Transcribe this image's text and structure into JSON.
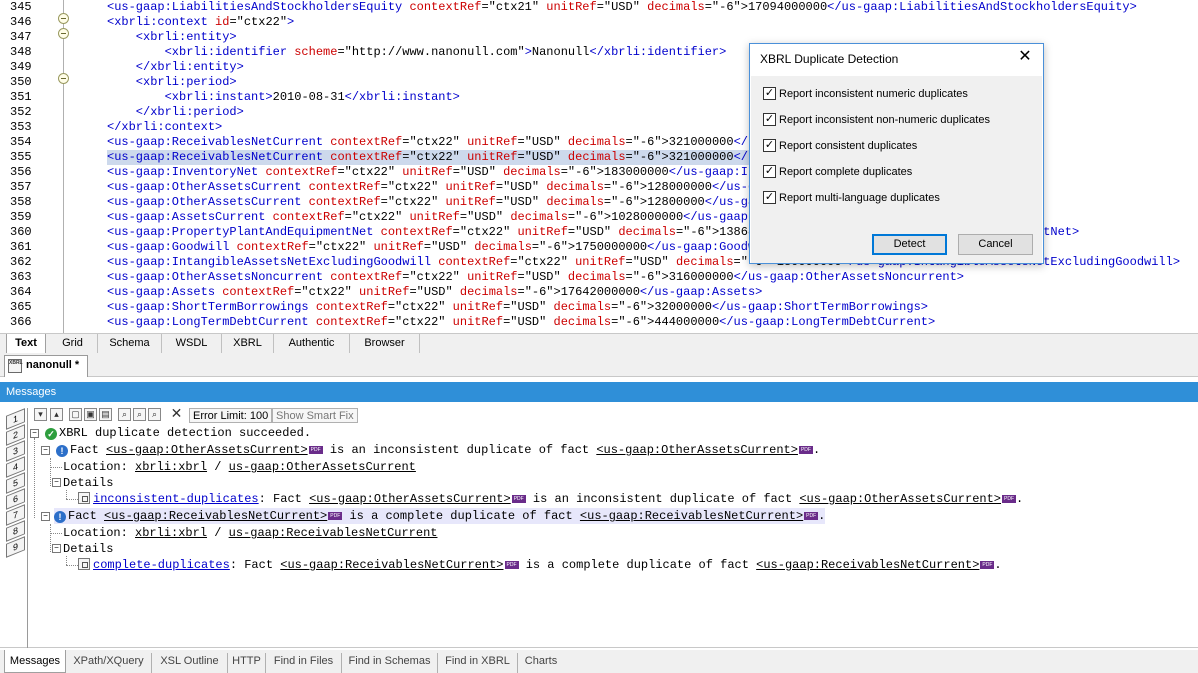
{
  "colors": {
    "tag": "#0000cc",
    "attr_name": "#cc0000",
    "attr_value": "#000000",
    "text": "#000000",
    "highlight_line": "#cdd9ec",
    "messages_header": "#2f8fd8",
    "highlight_message": "#e7e7fb"
  },
  "editor": {
    "lines": [
      {
        "num": "345",
        "segments": [
          [
            "t",
            "<us-gaap:LiabilitiesAndStockholdersEquity "
          ],
          [
            "a",
            "contextRef"
          ],
          [
            "x",
            "=\"ctx21\" "
          ],
          [
            "a",
            "unitRef"
          ],
          [
            "x",
            "=\"USD\" "
          ],
          [
            "a",
            "decimals"
          ],
          [
            "x",
            "=\"-6\">17094000000"
          ],
          [
            "t",
            "</us-gaap:LiabilitiesAndStockholdersEquity>"
          ]
        ]
      },
      {
        "num": "346",
        "segments": [
          [
            "t",
            "<xbrli:context "
          ],
          [
            "a",
            "id"
          ],
          [
            "x",
            "=\"ctx22\""
          ],
          [
            "t",
            ">"
          ]
        ]
      },
      {
        "num": "347",
        "segments": [
          [
            "t",
            "    <xbrli:entity>"
          ]
        ]
      },
      {
        "num": "348",
        "segments": [
          [
            "t",
            "        <xbrli:identifier "
          ],
          [
            "a",
            "scheme"
          ],
          [
            "x",
            "=\"http://www.nanonull.com\""
          ],
          [
            "t",
            ">"
          ],
          [
            "x",
            "Nanonull"
          ],
          [
            "t",
            "</xbrli:identifier>"
          ]
        ]
      },
      {
        "num": "349",
        "segments": [
          [
            "t",
            "    </xbrli:entity>"
          ]
        ]
      },
      {
        "num": "350",
        "segments": [
          [
            "t",
            "    <xbrli:period>"
          ]
        ]
      },
      {
        "num": "351",
        "segments": [
          [
            "t",
            "        <xbrli:instant>"
          ],
          [
            "x",
            "2010-08-31"
          ],
          [
            "t",
            "</xbrli:instant>"
          ]
        ]
      },
      {
        "num": "352",
        "segments": [
          [
            "t",
            "    </xbrli:period>"
          ]
        ]
      },
      {
        "num": "353",
        "segments": [
          [
            "t",
            "</xbrli:context>"
          ]
        ]
      },
      {
        "num": "354",
        "segments": [
          [
            "t",
            "<us-gaap:ReceivablesNetCurrent "
          ],
          [
            "a",
            "contextRef"
          ],
          [
            "x",
            "=\"ctx22\" "
          ],
          [
            "a",
            "unitRef"
          ],
          [
            "x",
            "=\"USD\" "
          ],
          [
            "a",
            "decimals"
          ],
          [
            "x",
            "=\"-6\">321000000"
          ],
          [
            "t",
            "</us-gaap:ReceivablesNetCurrent>"
          ]
        ]
      },
      {
        "num": "355",
        "highlight": true,
        "segments": [
          [
            "t",
            "<us-gaap:ReceivablesNetCurrent "
          ],
          [
            "a",
            "contextRef"
          ],
          [
            "x",
            "=\"ctx22\" "
          ],
          [
            "a",
            "unitRef"
          ],
          [
            "x",
            "=\"USD\" "
          ],
          [
            "a",
            "decimals"
          ],
          [
            "x",
            "=\"-6\">321000000"
          ],
          [
            "t",
            "</us-gaap:ReceivablesNetCurrent>"
          ]
        ]
      },
      {
        "num": "356",
        "segments": [
          [
            "t",
            "<us-gaap:InventoryNet "
          ],
          [
            "a",
            "contextRef"
          ],
          [
            "x",
            "=\"ctx22\" "
          ],
          [
            "a",
            "unitRef"
          ],
          [
            "x",
            "=\"USD\" "
          ],
          [
            "a",
            "decimals"
          ],
          [
            "x",
            "=\"-6\">183000000"
          ],
          [
            "t",
            "</us-gaap:InventoryNet>"
          ]
        ]
      },
      {
        "num": "357",
        "segments": [
          [
            "t",
            "<us-gaap:OtherAssetsCurrent "
          ],
          [
            "a",
            "contextRef"
          ],
          [
            "x",
            "=\"ctx22\" "
          ],
          [
            "a",
            "unitRef"
          ],
          [
            "x",
            "=\"USD\" "
          ],
          [
            "a",
            "decimals"
          ],
          [
            "x",
            "=\"-6\">128000000"
          ],
          [
            "t",
            "</us-gaap:OtherAssetsCurrent>"
          ]
        ]
      },
      {
        "num": "358",
        "segments": [
          [
            "t",
            "<us-gaap:OtherAssetsCurrent "
          ],
          [
            "a",
            "contextRef"
          ],
          [
            "x",
            "=\"ctx22\" "
          ],
          [
            "a",
            "unitRef"
          ],
          [
            "x",
            "=\"USD\" "
          ],
          [
            "a",
            "decimals"
          ],
          [
            "x",
            "=\"-6\">12800000"
          ],
          [
            "t",
            "</us-gaap:OtherAssetsCurrent>"
          ]
        ]
      },
      {
        "num": "359",
        "segments": [
          [
            "t",
            "<us-gaap:AssetsCurrent "
          ],
          [
            "a",
            "contextRef"
          ],
          [
            "x",
            "=\"ctx22\" "
          ],
          [
            "a",
            "unitRef"
          ],
          [
            "x",
            "=\"USD\" "
          ],
          [
            "a",
            "decimals"
          ],
          [
            "x",
            "=\"-6\">1028000000"
          ],
          [
            "t",
            "</us-gaap:AssetsCurrent>"
          ]
        ]
      },
      {
        "num": "360",
        "segments": [
          [
            "t",
            "<us-gaap:PropertyPlantAndEquipmentNet "
          ],
          [
            "a",
            "contextRef"
          ],
          [
            "x",
            "=\"ctx22\" "
          ],
          [
            "a",
            "unitRef"
          ],
          [
            "x",
            "=\"USD\" "
          ],
          [
            "a",
            "decimals"
          ],
          [
            "x",
            "=\"-6\">13868000000"
          ],
          [
            "t",
            "</us-gaap:PropertyPlantAndEquipmentNet>"
          ]
        ]
      },
      {
        "num": "361",
        "segments": [
          [
            "t",
            "<us-gaap:Goodwill "
          ],
          [
            "a",
            "contextRef"
          ],
          [
            "x",
            "=\"ctx22\" "
          ],
          [
            "a",
            "unitRef"
          ],
          [
            "x",
            "=\"USD\" "
          ],
          [
            "a",
            "decimals"
          ],
          [
            "x",
            "=\"-6\">1750000000"
          ],
          [
            "t",
            "</us-gaap:Goodwill>"
          ]
        ]
      },
      {
        "num": "362",
        "segments": [
          [
            "t",
            "<us-gaap:IntangibleAssetsNetExcludingGoodwill "
          ],
          [
            "a",
            "contextRef"
          ],
          [
            "x",
            "=\"ctx22\" "
          ],
          [
            "a",
            "unitRef"
          ],
          [
            "x",
            "=\"USD\" "
          ],
          [
            "a",
            "decimals"
          ],
          [
            "x",
            "=\"-6\">130000000"
          ],
          [
            "t",
            "</us-gaap:IntangibleAssetsNetExcludingGoodwill>"
          ]
        ]
      },
      {
        "num": "363",
        "segments": [
          [
            "t",
            "<us-gaap:OtherAssetsNoncurrent "
          ],
          [
            "a",
            "contextRef"
          ],
          [
            "x",
            "=\"ctx22\" "
          ],
          [
            "a",
            "unitRef"
          ],
          [
            "x",
            "=\"USD\" "
          ],
          [
            "a",
            "decimals"
          ],
          [
            "x",
            "=\"-6\">316000000"
          ],
          [
            "t",
            "</us-gaap:OtherAssetsNoncurrent>"
          ]
        ]
      },
      {
        "num": "364",
        "segments": [
          [
            "t",
            "<us-gaap:Assets "
          ],
          [
            "a",
            "contextRef"
          ],
          [
            "x",
            "=\"ctx22\" "
          ],
          [
            "a",
            "unitRef"
          ],
          [
            "x",
            "=\"USD\" "
          ],
          [
            "a",
            "decimals"
          ],
          [
            "x",
            "=\"-6\">17642000000"
          ],
          [
            "t",
            "</us-gaap:Assets>"
          ]
        ]
      },
      {
        "num": "365",
        "segments": [
          [
            "t",
            "<us-gaap:ShortTermBorrowings "
          ],
          [
            "a",
            "contextRef"
          ],
          [
            "x",
            "=\"ctx22\" "
          ],
          [
            "a",
            "unitRef"
          ],
          [
            "x",
            "=\"USD\" "
          ],
          [
            "a",
            "decimals"
          ],
          [
            "x",
            "=\"-6\">32000000"
          ],
          [
            "t",
            "</us-gaap:ShortTermBorrowings>"
          ]
        ]
      },
      {
        "num": "366",
        "segments": [
          [
            "t",
            "<us-gaap:LongTermDebtCurrent "
          ],
          [
            "a",
            "contextRef"
          ],
          [
            "x",
            "=\"ctx22\" "
          ],
          [
            "a",
            "unitRef"
          ],
          [
            "x",
            "=\"USD\" "
          ],
          [
            "a",
            "decimals"
          ],
          [
            "x",
            "=\"-6\">444000000"
          ],
          [
            "t",
            "</us-gaap:LongTermDebtCurrent>"
          ]
        ]
      }
    ]
  },
  "dialog": {
    "title": "XBRL Duplicate Detection",
    "close_glyph": "✕",
    "checkboxes": [
      {
        "label": "Report inconsistent numeric duplicates",
        "checked": true
      },
      {
        "label": "Report inconsistent non-numeric duplicates",
        "checked": true
      },
      {
        "label": "Report consistent duplicates",
        "checked": true
      },
      {
        "label": "Report complete duplicates",
        "checked": true
      },
      {
        "label": "Report multi-language duplicates",
        "checked": true
      }
    ],
    "detect_label": "Detect",
    "cancel_label": "Cancel"
  },
  "view_tabs": [
    {
      "label": "Text",
      "active": true
    },
    {
      "label": "Grid"
    },
    {
      "label": "Schema"
    },
    {
      "label": "WSDL"
    },
    {
      "label": "XBRL"
    },
    {
      "label": "Authentic"
    },
    {
      "label": "Browser"
    }
  ],
  "document_tab": {
    "label": "nanonull *",
    "icon_text": "XBRL"
  },
  "messages": {
    "title": "Messages",
    "side_tabs": [
      "1",
      "2",
      "3",
      "4",
      "5",
      "6",
      "7",
      "8",
      "9"
    ],
    "toolbar": {
      "error_limit": "Error Limit: 100",
      "smart_fix": "Show Smart Fix"
    },
    "pdf_text": "PDF",
    "ok_glyph": "✓",
    "info_glyph": "!",
    "summary": "XBRL duplicate detection succeeded.",
    "fact_word": "Fact",
    "location_label": "Location:",
    "location_sep": "/",
    "details_label": "Details",
    "items": [
      {
        "fact": "<us-gaap:OtherAssetsCurrent>",
        "phrase": "is an inconsistent duplicate of fact",
        "other_fact": "<us-gaap:OtherAssetsCurrent>",
        "end": ".",
        "location_ns": "xbrli:xbrl",
        "location_el": "us-gaap:OtherAssetsCurrent",
        "detail_link": "inconsistent-duplicates",
        "detail_text": ": Fact",
        "detail_fact": "<us-gaap:OtherAssetsCurrent>",
        "detail_phrase": "is an inconsistent duplicate of fact",
        "detail_other": "<us-gaap:OtherAssetsCurrent>",
        "detail_end": "."
      },
      {
        "fact": "<us-gaap:ReceivablesNetCurrent>",
        "phrase": "is a complete duplicate of fact",
        "other_fact": "<us-gaap:ReceivablesNetCurrent>",
        "end": ".",
        "location_ns": "xbrli:xbrl",
        "location_el": "us-gaap:ReceivablesNetCurrent",
        "detail_link": "complete-duplicates",
        "detail_text": ": Fact",
        "detail_fact": "<us-gaap:ReceivablesNetCurrent>",
        "detail_phrase": "is a complete duplicate of fact",
        "detail_other": "<us-gaap:ReceivablesNetCurrent>",
        "detail_end": "."
      }
    ]
  },
  "bottom_tabs": [
    {
      "label": "Messages",
      "active": true
    },
    {
      "label": "XPath/XQuery"
    },
    {
      "label": "XSL Outline"
    },
    {
      "label": "HTTP"
    },
    {
      "label": "Find in Files"
    },
    {
      "label": "Find in Schemas"
    },
    {
      "label": "Find in XBRL"
    },
    {
      "label": "Charts"
    }
  ]
}
